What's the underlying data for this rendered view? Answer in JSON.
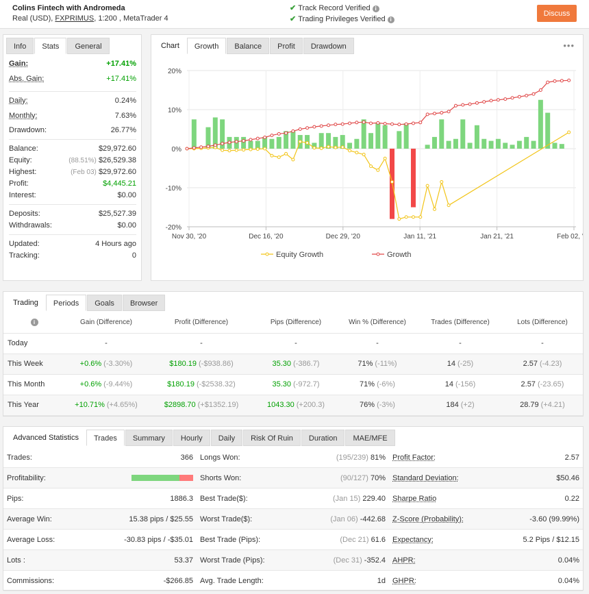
{
  "header": {
    "account_name": "Colins Fintech with Andromeda",
    "account_type": "Real (USD),",
    "broker": "FXPRIMUS",
    "leverage_platform": ", 1:200 , MetaTrader 4",
    "track_record": "Track Record Verified",
    "trading_privileges": "Trading Privileges Verified",
    "discuss_label": "Discuss"
  },
  "info_panel": {
    "tabs": [
      "Info",
      "Stats",
      "General"
    ],
    "active_tab": "Stats",
    "gain_label": "Gain:",
    "gain": "+17.41%",
    "abs_gain_label": "Abs. Gain:",
    "abs_gain": "+17.41%",
    "daily_label": "Daily:",
    "daily": "0.24%",
    "monthly_label": "Monthly:",
    "monthly": "7.63%",
    "drawdown_label": "Drawdown:",
    "drawdown": "26.77%",
    "balance_label": "Balance:",
    "balance": "$29,972.60",
    "equity_label": "Equity:",
    "equity_pct": "(88.51%)",
    "equity": "$26,529.38",
    "highest_label": "Highest:",
    "highest_date": "(Feb 03)",
    "highest": "$29,972.60",
    "profit_label": "Profit:",
    "profit": "$4,445.21",
    "interest_label": "Interest:",
    "interest": "$0.00",
    "deposits_label": "Deposits:",
    "deposits": "$25,527.39",
    "withdrawals_label": "Withdrawals:",
    "withdrawals": "$0.00",
    "updated_label": "Updated:",
    "updated": "4 Hours ago",
    "tracking_label": "Tracking:",
    "tracking": "0"
  },
  "chart_panel": {
    "tabs": [
      "Chart",
      "Growth",
      "Balance",
      "Profit",
      "Drawdown"
    ],
    "active_tab": "Growth",
    "menu_icon": "ellipsis-icon"
  },
  "chart_data": {
    "type": "bar",
    "x_tick_labels": [
      "Nov 30, '20",
      "Dec 16, '20",
      "Dec 29, '20",
      "Jan 11, '21",
      "Jan 21, '21",
      "Feb 02, '21"
    ],
    "y_ticks": [
      "20%",
      "10%",
      "0%",
      "-10%",
      "-20%"
    ],
    "ylim": [
      -20,
      20
    ],
    "x_range": [
      0,
      55
    ],
    "grid": true,
    "legend_position": "bottom",
    "series": [
      {
        "name": "Equity Growth",
        "type": "line",
        "color": "#f2c417",
        "points": [
          [
            0,
            0
          ],
          [
            1,
            0
          ],
          [
            2,
            0.1
          ],
          [
            3,
            0.2
          ],
          [
            4,
            0.3
          ],
          [
            5,
            -0.4
          ],
          [
            6,
            -0.5
          ],
          [
            7,
            -0.4
          ],
          [
            8,
            -0.3
          ],
          [
            9,
            -0.2
          ],
          [
            10,
            -0.1
          ],
          [
            11,
            0
          ],
          [
            12,
            -1.8
          ],
          [
            13,
            -2.2
          ],
          [
            14,
            -1.3
          ],
          [
            15,
            -2.8
          ],
          [
            16,
            1.8
          ],
          [
            17,
            1.5
          ],
          [
            18,
            0.2
          ],
          [
            19,
            0.1
          ],
          [
            20,
            0.5
          ],
          [
            21,
            0.3
          ],
          [
            22,
            0.4
          ],
          [
            23,
            -0.5
          ],
          [
            24,
            -1
          ],
          [
            25,
            -1.5
          ],
          [
            26,
            -4.5
          ],
          [
            27,
            -5.5
          ],
          [
            28,
            -2.5
          ],
          [
            29,
            -8.5
          ],
          [
            30,
            -18
          ],
          [
            31,
            -17.5
          ],
          [
            32,
            -17.5
          ],
          [
            33,
            -17.5
          ],
          [
            34,
            -9.5
          ],
          [
            35,
            -15.5
          ],
          [
            36,
            -8.5
          ],
          [
            37,
            -14.5
          ],
          [
            54,
            4.2
          ]
        ]
      },
      {
        "name": "Growth",
        "type": "line",
        "color": "#e04848",
        "points": [
          [
            0,
            0
          ],
          [
            1,
            0.2
          ],
          [
            2,
            0.4
          ],
          [
            3,
            0.6
          ],
          [
            4,
            0.9
          ],
          [
            5,
            1.3
          ],
          [
            6,
            1.6
          ],
          [
            7,
            1.8
          ],
          [
            8,
            2
          ],
          [
            9,
            2.3
          ],
          [
            10,
            2.6
          ],
          [
            11,
            2.9
          ],
          [
            12,
            3.4
          ],
          [
            13,
            3.8
          ],
          [
            14,
            4
          ],
          [
            15,
            4.5
          ],
          [
            16,
            5
          ],
          [
            17,
            5.3
          ],
          [
            18,
            5.6
          ],
          [
            19,
            5.8
          ],
          [
            20,
            6
          ],
          [
            21,
            6.2
          ],
          [
            22,
            6.3
          ],
          [
            23,
            6.5
          ],
          [
            24,
            6.7
          ],
          [
            25,
            6.8
          ],
          [
            26,
            6.5
          ],
          [
            27,
            6.6
          ],
          [
            28,
            6.4
          ],
          [
            29,
            6.3
          ],
          [
            30,
            6.2
          ],
          [
            31,
            6.3
          ],
          [
            32,
            6.5
          ],
          [
            33,
            6.7
          ],
          [
            34,
            8.8
          ],
          [
            35,
            9
          ],
          [
            36,
            9.2
          ],
          [
            37,
            9.5
          ],
          [
            38,
            11
          ],
          [
            39,
            11.2
          ],
          [
            40,
            11.4
          ],
          [
            41,
            11.7
          ],
          [
            42,
            12
          ],
          [
            43,
            12.3
          ],
          [
            44,
            12.5
          ],
          [
            45,
            12.7
          ],
          [
            46,
            13
          ],
          [
            47,
            13.3
          ],
          [
            48,
            13.6
          ],
          [
            49,
            14
          ],
          [
            50,
            15
          ],
          [
            51,
            17
          ],
          [
            52,
            17.3
          ],
          [
            53,
            17.4
          ],
          [
            54,
            17.5
          ]
        ]
      },
      {
        "name": "Daily gain",
        "type": "bar",
        "color_positive": "#7ed67e",
        "color_negative": "#f24848",
        "points": [
          [
            1,
            7.5
          ],
          [
            3,
            5.5
          ],
          [
            4,
            8
          ],
          [
            5,
            7.5
          ],
          [
            6,
            3
          ],
          [
            7,
            3
          ],
          [
            8,
            3
          ],
          [
            9,
            2
          ],
          [
            10,
            2
          ],
          [
            11,
            3
          ],
          [
            12,
            2.5
          ],
          [
            13,
            3
          ],
          [
            14,
            4.5
          ],
          [
            15,
            4.5
          ],
          [
            16,
            3.5
          ],
          [
            17,
            3.5
          ],
          [
            18,
            1.5
          ],
          [
            19,
            4
          ],
          [
            20,
            4
          ],
          [
            21,
            3
          ],
          [
            22,
            3.5
          ],
          [
            23,
            1.5
          ],
          [
            24,
            2.5
          ],
          [
            25,
            7.5
          ],
          [
            26,
            4
          ],
          [
            27,
            6.5
          ],
          [
            28,
            6
          ],
          [
            29,
            -18
          ],
          [
            30,
            4.5
          ],
          [
            31,
            6.5
          ],
          [
            32,
            -15
          ],
          [
            34,
            1
          ],
          [
            35,
            3
          ],
          [
            36,
            7.5
          ],
          [
            37,
            2
          ],
          [
            38,
            2.5
          ],
          [
            39,
            7.5
          ],
          [
            40,
            1.5
          ],
          [
            41,
            6
          ],
          [
            42,
            2.5
          ],
          [
            43,
            2
          ],
          [
            44,
            2.5
          ],
          [
            45,
            1.5
          ],
          [
            46,
            1
          ],
          [
            47,
            2
          ],
          [
            48,
            3
          ],
          [
            49,
            2
          ],
          [
            50,
            12.5
          ],
          [
            51,
            9.2
          ],
          [
            52,
            1.5
          ],
          [
            53,
            1.2
          ]
        ]
      }
    ]
  },
  "periods_panel": {
    "tabs": [
      "Trading",
      "Periods",
      "Goals",
      "Browser"
    ],
    "active_tab": "Periods",
    "columns": [
      "Gain (Difference)",
      "Profit (Difference)",
      "Pips (Difference)",
      "Win % (Difference)",
      "Trades (Difference)",
      "Lots (Difference)"
    ],
    "rows": [
      {
        "period": "Today",
        "gain": "-",
        "gain_diff": "",
        "profit": "-",
        "profit_diff": "",
        "pips": "-",
        "pips_diff": "",
        "win": "-",
        "win_diff": "",
        "trades": "-",
        "trades_diff": "",
        "lots": "-",
        "lots_diff": ""
      },
      {
        "period": "This Week",
        "gain": "+0.6%",
        "gain_diff": "(-3.30%)",
        "profit": "$180.19",
        "profit_diff": "(-$938.86)",
        "pips": "35.30",
        "pips_diff": "(-386.7)",
        "win": "71%",
        "win_diff": "(-11%)",
        "trades": "14",
        "trades_diff": "(-25)",
        "lots": "2.57",
        "lots_diff": "(-4.23)"
      },
      {
        "period": "This Month",
        "gain": "+0.6%",
        "gain_diff": "(-9.44%)",
        "profit": "$180.19",
        "profit_diff": "(-$2538.32)",
        "pips": "35.30",
        "pips_diff": "(-972.7)",
        "win": "71%",
        "win_diff": "(-6%)",
        "trades": "14",
        "trades_diff": "(-156)",
        "lots": "2.57",
        "lots_diff": "(-23.65)"
      },
      {
        "period": "This Year",
        "gain": "+10.71%",
        "gain_diff": "(+4.65%)",
        "profit": "$2898.70",
        "profit_diff": "(+$1352.19)",
        "pips": "1043.30",
        "pips_diff": "(+200.3)",
        "win": "76%",
        "win_diff": "(-3%)",
        "trades": "184",
        "trades_diff": "(+2)",
        "lots": "28.79",
        "lots_diff": "(+4.21)"
      }
    ]
  },
  "advanced_panel": {
    "title": "Advanced Statistics",
    "tabs": [
      "Trades",
      "Summary",
      "Hourly",
      "Daily",
      "Risk Of Ruin",
      "Duration",
      "MAE/MFE"
    ],
    "active_tab": "Trades",
    "col1": [
      {
        "label": "Trades:",
        "value": "366"
      },
      {
        "label": "Profitability:",
        "value": ""
      },
      {
        "label": "Pips:",
        "value": "1886.3"
      },
      {
        "label": "Average Win:",
        "value": "15.38 pips / $25.55"
      },
      {
        "label": "Average Loss:",
        "value": "-30.83 pips / -$35.01"
      },
      {
        "label": "Lots :",
        "value": "53.37"
      },
      {
        "label": "Commissions:",
        "value": "-$266.85"
      }
    ],
    "profitability_win_fraction": 0.78,
    "col2": [
      {
        "label": "Longs Won:",
        "note": "(195/239)",
        "value": "81%"
      },
      {
        "label": "Shorts Won:",
        "note": "(90/127)",
        "value": "70%"
      },
      {
        "label": "Best Trade($):",
        "note": "(Jan 15)",
        "value": "229.40"
      },
      {
        "label": "Worst Trade($):",
        "note": "(Jan 06)",
        "value": "-442.68"
      },
      {
        "label": "Best Trade (Pips):",
        "note": "(Dec 21)",
        "value": "61.6"
      },
      {
        "label": "Worst Trade (Pips):",
        "note": "(Dec 31)",
        "value": "-352.4"
      },
      {
        "label": "Avg. Trade Length:",
        "note": "",
        "value": "1d"
      }
    ],
    "col3": [
      {
        "label": "Profit Factor:",
        "value": "2.57"
      },
      {
        "label": "Standard Deviation:",
        "value": "$50.46"
      },
      {
        "label": "Sharpe Ratio",
        "value": "0.22"
      },
      {
        "label": "Z-Score (Probability):",
        "value": "-3.60 (99.99%)"
      },
      {
        "label": "Expectancy:",
        "value": "5.2 Pips / $12.15"
      },
      {
        "label": "AHPR:",
        "value": "0.04%"
      },
      {
        "label": "GHPR:",
        "value": "0.04%"
      }
    ]
  }
}
